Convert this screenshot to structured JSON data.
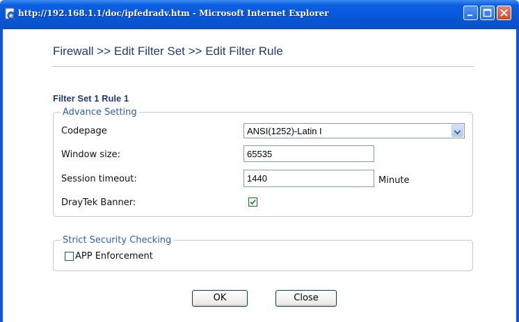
{
  "window": {
    "title": "http://192.168.1.1/doc/ipfedradv.htm - Microsoft Internet Explorer"
  },
  "page": {
    "title": "Firewall >> Edit Filter Set >> Edit Filter Rule",
    "section_title": "Filter Set 1 Rule 1"
  },
  "advance_setting": {
    "legend": "Advance Setting",
    "codepage": {
      "label": "Codepage",
      "value": "ANSI(1252)-Latin I"
    },
    "window_size": {
      "label": "Window size:",
      "value": "65535"
    },
    "session_timeout": {
      "label": "Session timeout:",
      "value": "1440",
      "unit": "Minute"
    },
    "draytek_banner": {
      "label": "DrayTek Banner:",
      "checked": true
    }
  },
  "strict_security": {
    "legend": "Strict Security Checking",
    "app_enforcement": {
      "label": "APP Enforcement",
      "checked": false
    }
  },
  "buttons": {
    "ok": "OK",
    "close": "Close"
  },
  "colors": {
    "titlebar": "#0756d8",
    "heading": "#1f3a78",
    "legend": "#2a60c4"
  }
}
